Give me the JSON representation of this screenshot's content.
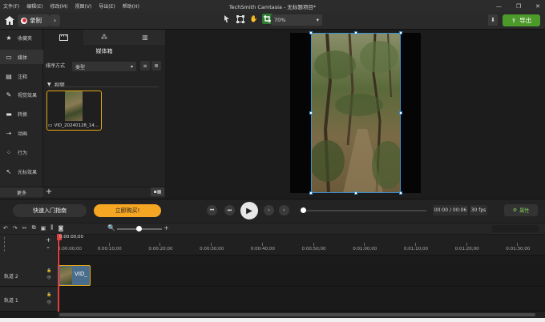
{
  "app": {
    "title": "TechSmith Camtasia - 无标题项目*",
    "menu": [
      "文件(F)",
      "编辑(E)",
      "修改(M)",
      "视图(V)",
      "导出(E)",
      "帮助(H)"
    ]
  },
  "toolbar": {
    "record_label": "录制",
    "zoom_value": "70%",
    "export_label": "导出"
  },
  "sidebar": {
    "items": [
      {
        "label": "收藏夹",
        "icon": "star-icon"
      },
      {
        "label": "媒体",
        "icon": "media-icon"
      },
      {
        "label": "注释",
        "icon": "annotation-icon"
      },
      {
        "label": "视觉效果",
        "icon": "visual-effects-icon"
      },
      {
        "label": "转换",
        "icon": "transition-icon"
      },
      {
        "label": "动画",
        "icon": "animation-icon"
      },
      {
        "label": "行为",
        "icon": "behavior-icon"
      },
      {
        "label": "光标效果",
        "icon": "cursor-effects-icon"
      }
    ],
    "more_label": "更多"
  },
  "bin": {
    "title": "媒体箱",
    "sort_label": "排序方式",
    "sort_value": "类型",
    "section_label": "视频",
    "clip_name": "VID_20240128_14..."
  },
  "playback": {
    "guide_label": "快速入门指南",
    "buy_label": "立即购买!",
    "time_display": "00:00 / 00:06",
    "fps": "30 fps",
    "properties_label": "属性"
  },
  "timeline": {
    "playhead_time": "0:00:00;00",
    "ticks": [
      "0:00:00;00",
      "0:00:10;00",
      "0:00:20;00",
      "0:00:30;00",
      "0:00:40;00",
      "0:00:50;00",
      "0:01:00;00",
      "0:01:10;00",
      "0:01:20;00",
      "0:01:30;00"
    ],
    "tracks": [
      {
        "label": "轨道 2",
        "clip_label": "VID_"
      },
      {
        "label": "轨道 1"
      }
    ]
  },
  "colors": {
    "accent_green": "#4c9a2a",
    "buy_orange": "#f5a623",
    "selection_yellow": "#e6a817",
    "record_red": "#e0303a"
  }
}
